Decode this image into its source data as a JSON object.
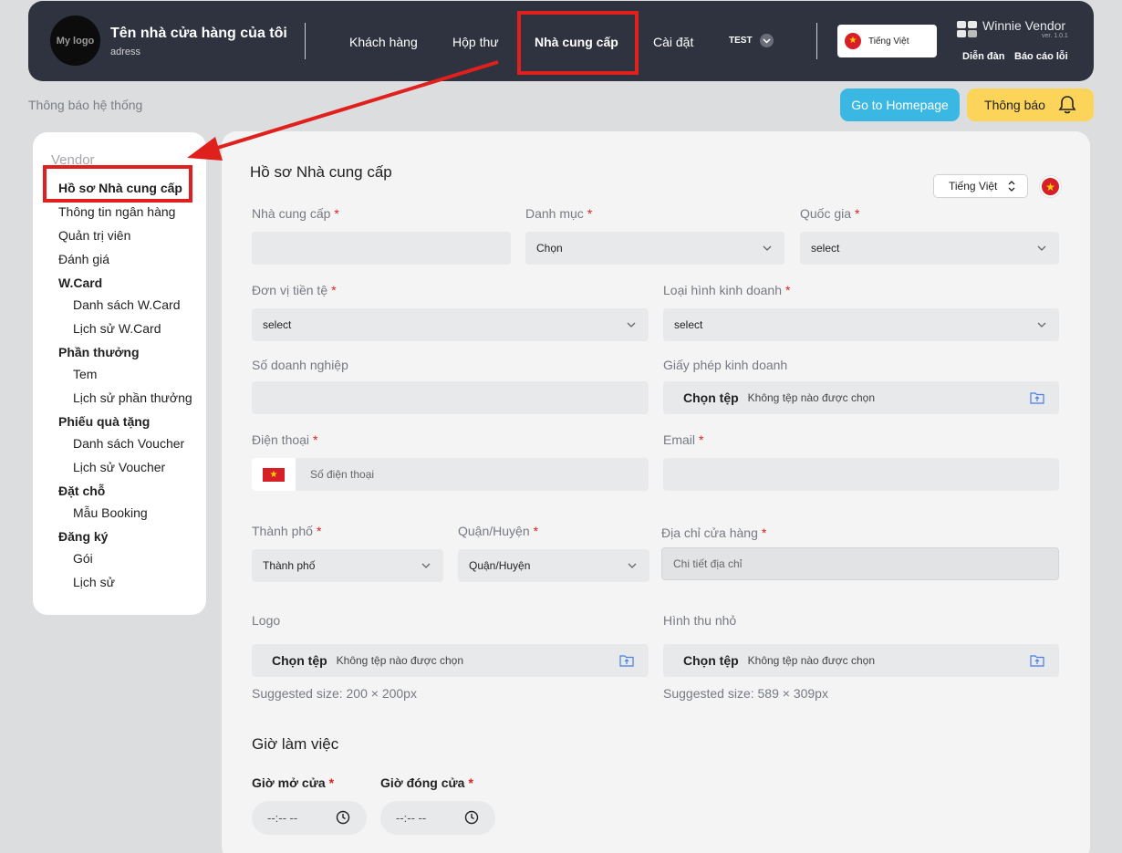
{
  "header": {
    "logo_text": "My logo",
    "store_name": "Tên nhà cửa hàng của tôi",
    "store_address": "adress",
    "nav": [
      "Khách hàng",
      "Hộp thư",
      "Nhà cung cấp",
      "Cài đặt"
    ],
    "test_label": "TEST",
    "language": "Tiếng Việt",
    "brand": "Winnie Vendor",
    "version": "ver. 1.0.1",
    "forum_link": "Diễn đàn",
    "report_link": "Báo cáo lỗi"
  },
  "subheader": {
    "system_notice": "Thông báo hệ thống",
    "homepage_button": "Go to Homepage",
    "notify_button": "Thông báo"
  },
  "sidebar": {
    "heading": "Vendor",
    "items": {
      "profile": "Hồ sơ Nhà cung cấp",
      "bank": "Thông tin ngân hàng",
      "admin": "Quản trị viên",
      "review": "Đánh giá",
      "wcard": "W.Card",
      "wcard_list": "Danh sách W.Card",
      "wcard_history": "Lịch sử W.Card",
      "rewards": "Phần thưởng",
      "stamp": "Tem",
      "reward_history": "Lịch sử phần thưởng",
      "gift": "Phiếu quà tặng",
      "voucher_list": "Danh sách Voucher",
      "voucher_history": "Lịch sử Voucher",
      "booking": "Đặt chỗ",
      "booking_template": "Mẫu Booking",
      "register": "Đăng ký",
      "package": "Gói",
      "history": "Lịch sử"
    }
  },
  "form": {
    "title": "Hồ sơ Nhà cung cấp",
    "language_select": "Tiếng Việt",
    "supplier_label": "Nhà cung cấp",
    "category_label": "Danh mục",
    "category_value": "Chọn",
    "country_label": "Quốc gia",
    "country_value": "select",
    "currency_label": "Đơn vị tiền tệ",
    "currency_value": "select",
    "business_type_label": "Loại hình kinh doanh",
    "business_type_value": "select",
    "business_number_label": "Số doanh nghiệp",
    "license_label": "Giấy phép kinh doanh",
    "file_button": "Chọn tệp",
    "no_file": "Không tệp nào được chọn",
    "phone_label": "Điện thoại",
    "phone_placeholder": "Số điện thoại",
    "email_label": "Email",
    "city_label": "Thành phố",
    "city_value": "Thành phố",
    "district_label": "Quận/Huyện",
    "district_value": "Quận/Huyện",
    "address_label": "Địa chỉ cửa hàng",
    "address_placeholder": "Chi tiết địa chỉ",
    "logo_label": "Logo",
    "logo_hint": "Suggested size: 200 × 200px",
    "thumb_label": "Hình thu nhỏ",
    "thumb_hint": "Suggested size: 589 × 309px",
    "hours_title": "Giờ làm việc",
    "open_label": "Giờ mở cửa",
    "close_label": "Giờ đóng cửa",
    "time_placeholder": "--:-- --",
    "required_mark": "*"
  },
  "colors": {
    "header_bg": "#2f3340",
    "highlight_red": "#e0201c",
    "homepage_btn": "#3ab8e3",
    "notify_btn": "#fdd45a"
  }
}
